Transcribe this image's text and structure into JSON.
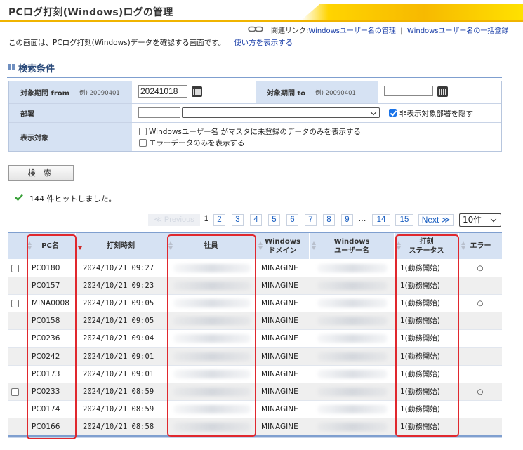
{
  "page": {
    "title": "PCログ打刻(Windows)ログの管理",
    "related_label": "関連リンク:",
    "related_links": [
      "Windowsユーザー名の管理",
      "Windowsユーザー名の一括登録"
    ],
    "related_sep": "|",
    "description": "この画面は、PCログ打刻(Windows)データを確認する画面です。",
    "howto_link": "使い方を表示する"
  },
  "search": {
    "section_title": "検索条件",
    "period_from_label": "対象期間 from",
    "period_from_example": "例) 20090401",
    "period_from_value": "20241018",
    "period_to_label": "対象期間 to",
    "period_to_example": "例) 20090401",
    "period_to_value": "",
    "dept_label": "部署",
    "dept_code_value": "",
    "dept_select_value": "",
    "hide_dept_label": "非表示対象部署を隠す",
    "hide_dept_checked": true,
    "target_label": "表示対象",
    "opt_unregistered": "Windowsユーザー名 がマスタに未登録のデータのみを表示する",
    "opt_errors": "エラーデータのみを表示する",
    "button_label": "検 索"
  },
  "result": {
    "hit_text": "144 件ヒットしました。"
  },
  "pagination": {
    "prev": "≪ Previous",
    "current": "1",
    "pages": [
      "2",
      "3",
      "4",
      "5",
      "6",
      "7",
      "8",
      "9"
    ],
    "dots": "…",
    "tail": [
      "14",
      "15"
    ],
    "next": "Next ≫",
    "page_size": "10件"
  },
  "table": {
    "headers": {
      "pc": "PC名",
      "time": "打刻時刻",
      "employee": "社員",
      "domain": "Windows\nドメイン",
      "username": "Windows\nユーザー名",
      "status": "打刻\nステータス",
      "error": "エラー"
    },
    "rows": [
      {
        "checkbox": true,
        "pc": "PC0180",
        "time": "2024/10/21 09:27",
        "domain": "MINAGINE",
        "status": "1(勤務開始)",
        "error": "○"
      },
      {
        "checkbox": false,
        "pc": "PC0157",
        "time": "2024/10/21 09:23",
        "domain": "MINAGINE",
        "status": "1(勤務開始)",
        "error": ""
      },
      {
        "checkbox": true,
        "pc": "MINA0008",
        "time": "2024/10/21 09:05",
        "domain": "MINAGINE",
        "status": "1(勤務開始)",
        "error": "○"
      },
      {
        "checkbox": false,
        "pc": "PC0158",
        "time": "2024/10/21 09:05",
        "domain": "MINAGINE",
        "status": "1(勤務開始)",
        "error": ""
      },
      {
        "checkbox": false,
        "pc": "PC0236",
        "time": "2024/10/21 09:04",
        "domain": "MINAGINE",
        "status": "1(勤務開始)",
        "error": ""
      },
      {
        "checkbox": false,
        "pc": "PC0242",
        "time": "2024/10/21 09:01",
        "domain": "MINAGINE",
        "status": "1(勤務開始)",
        "error": ""
      },
      {
        "checkbox": false,
        "pc": "PC0173",
        "time": "2024/10/21 09:01",
        "domain": "MINAGINE",
        "status": "1(勤務開始)",
        "error": ""
      },
      {
        "checkbox": true,
        "pc": "PC0233",
        "time": "2024/10/21 08:59",
        "domain": "MINAGINE",
        "status": "1(勤務開始)",
        "error": "○"
      },
      {
        "checkbox": false,
        "pc": "PC0174",
        "time": "2024/10/21 08:59",
        "domain": "MINAGINE",
        "status": "1(勤務開始)",
        "error": ""
      },
      {
        "checkbox": false,
        "pc": "PC0166",
        "time": "2024/10/21 08:58",
        "domain": "MINAGINE",
        "status": "1(勤務開始)",
        "error": ""
      }
    ]
  },
  "colors": {
    "header_accent": "#f0b400",
    "section_blue": "#7f9fcf",
    "label_bg": "#d6e2f3",
    "link": "#1a3ea8",
    "highlight_box": "#e0282e"
  }
}
